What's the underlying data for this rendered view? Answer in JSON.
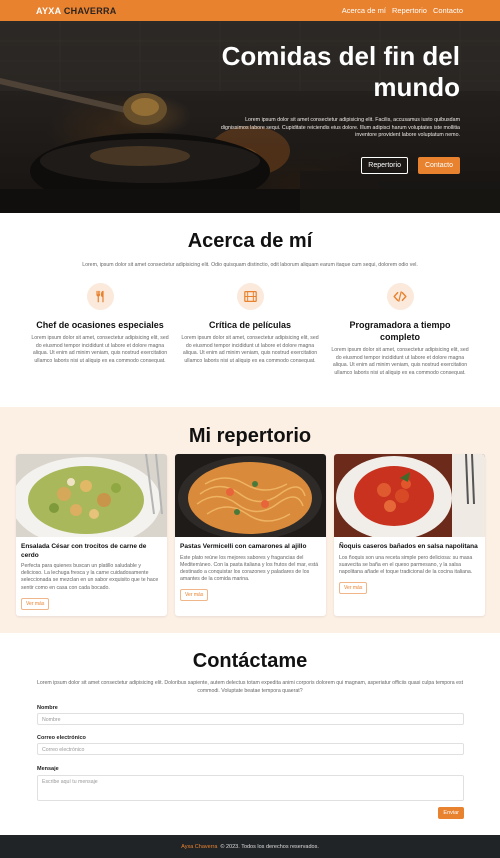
{
  "nav": {
    "brand_part1": "AYXA",
    "brand_part2": "CHAVERRA",
    "links": [
      "Acerca de mí",
      "Repertorio",
      "Contacto"
    ]
  },
  "hero": {
    "title": "Comidas del fin del mundo",
    "text": "Lorem ipsum dolor sit amet consectetur adipisicing elit. Facilis, accusamus iusto quibusdam dignissimos labore sequi. Cupiditate reiciendis eius dolore. Illum adipisci harum voluptates iste mollitia inventore provident labore voluptatum nemo.",
    "button_secondary": "Repertorio",
    "button_primary": "Contacto"
  },
  "about": {
    "title": "Acerca de mí",
    "intro": "Lorem, ipsum dolor sit amet consectetur adipisicing elit. Odio quisquam distinctio, odit laborum aliquam earum itaque cum sequi, dolorem odio vel.",
    "features": [
      {
        "icon": "utensils-icon",
        "title": "Chef de ocasiones especiales",
        "text": "Lorem ipsum dolor sit amet, consectetur adipisicing elit, sed do eiusmod tempor incididunt ut labore et dolore magna aliqua. Ut enim ad minim veniam, quis nostrud exercitation ullamco laboris nisi ut aliquip ex ea commodo consequat."
      },
      {
        "icon": "film-icon",
        "title": "Crítica de películas",
        "text": "Lorem ipsum dolor sit amet, consectetur adipisicing elit, sed do eiusmod tempor incididunt ut labore et dolore magna aliqua. Ut enim ad minim veniam, quis nostrud exercitation ullamco laboris nisi ut aliquip ex ea commodo consequat."
      },
      {
        "icon": "code-icon",
        "title": "Programadora a tiempo completo",
        "text": "Lorem ipsum dolor sit amet, consectetur adipisicing elit, sed do eiusmod tempor incididunt ut labore et dolore magna aliqua. Ut enim ad minim veniam, quis nostrud exercitation ullamco laboris nisi ut aliquip ex ea commodo consequat."
      }
    ]
  },
  "repertoire": {
    "title": "Mi repertorio",
    "cards": [
      {
        "image": "caesar-salad-photo",
        "title": "Ensalada César con trocitos de carne de cerdo",
        "text": "Perfecta para quienes buscan un platillo saludable y delicioso. La lechuga fresca y la carne cuidadosamente seleccionada se mezclan en un sabor exquisito que te hace sentir como en casa con cada bocado.",
        "button": "Ver más"
      },
      {
        "image": "vermicelli-shrimp-photo",
        "title": "Pastas Vermicelli con camarones al ajillo",
        "text": "Este plato reúne los mejores sabores y fragancias del Mediterráneo. Con la pasta italiana y los frutos del mar, está destinado a conquistar los corazones y paladares de los amantes de la comida marina.",
        "button": "Ver más"
      },
      {
        "image": "gnocchi-napolitana-photo",
        "title": "Ñoquis caseros bañados en salsa napolitana",
        "text": "Los ñoquis son una receta simple pero deliciosa: su masa suavecita se baña en el queso parmesano, y la salsa napolitana añade el toque tradicional de la cocina italiana.",
        "button": "Ver más"
      }
    ]
  },
  "contact": {
    "title": "Contáctame",
    "intro": "Lorem ipsum dolor sit amet consectetur adipisicing elit. Doloribus sapiente, autem delectus totam expedita animi corporis dolorem qui magnam, asperiatur officiis quasi culpa tempora est commodi. Voluptate beatae tempora quaerat?",
    "name_label": "Nombre",
    "name_placeholder": "Nombre",
    "email_label": "Correo electrónico",
    "email_placeholder": "Correo electrónico",
    "message_label": "Mensaje",
    "message_placeholder": "Escribe aquí tu mensaje",
    "send": "Enviar"
  },
  "footer": {
    "brand": "Ayxa Chaverra",
    "text": "© 2023. Todos los derechos reservados."
  },
  "colors": {
    "accent": "#e8822f",
    "accent_light": "#fcefe4",
    "footer_bg": "#212427"
  }
}
